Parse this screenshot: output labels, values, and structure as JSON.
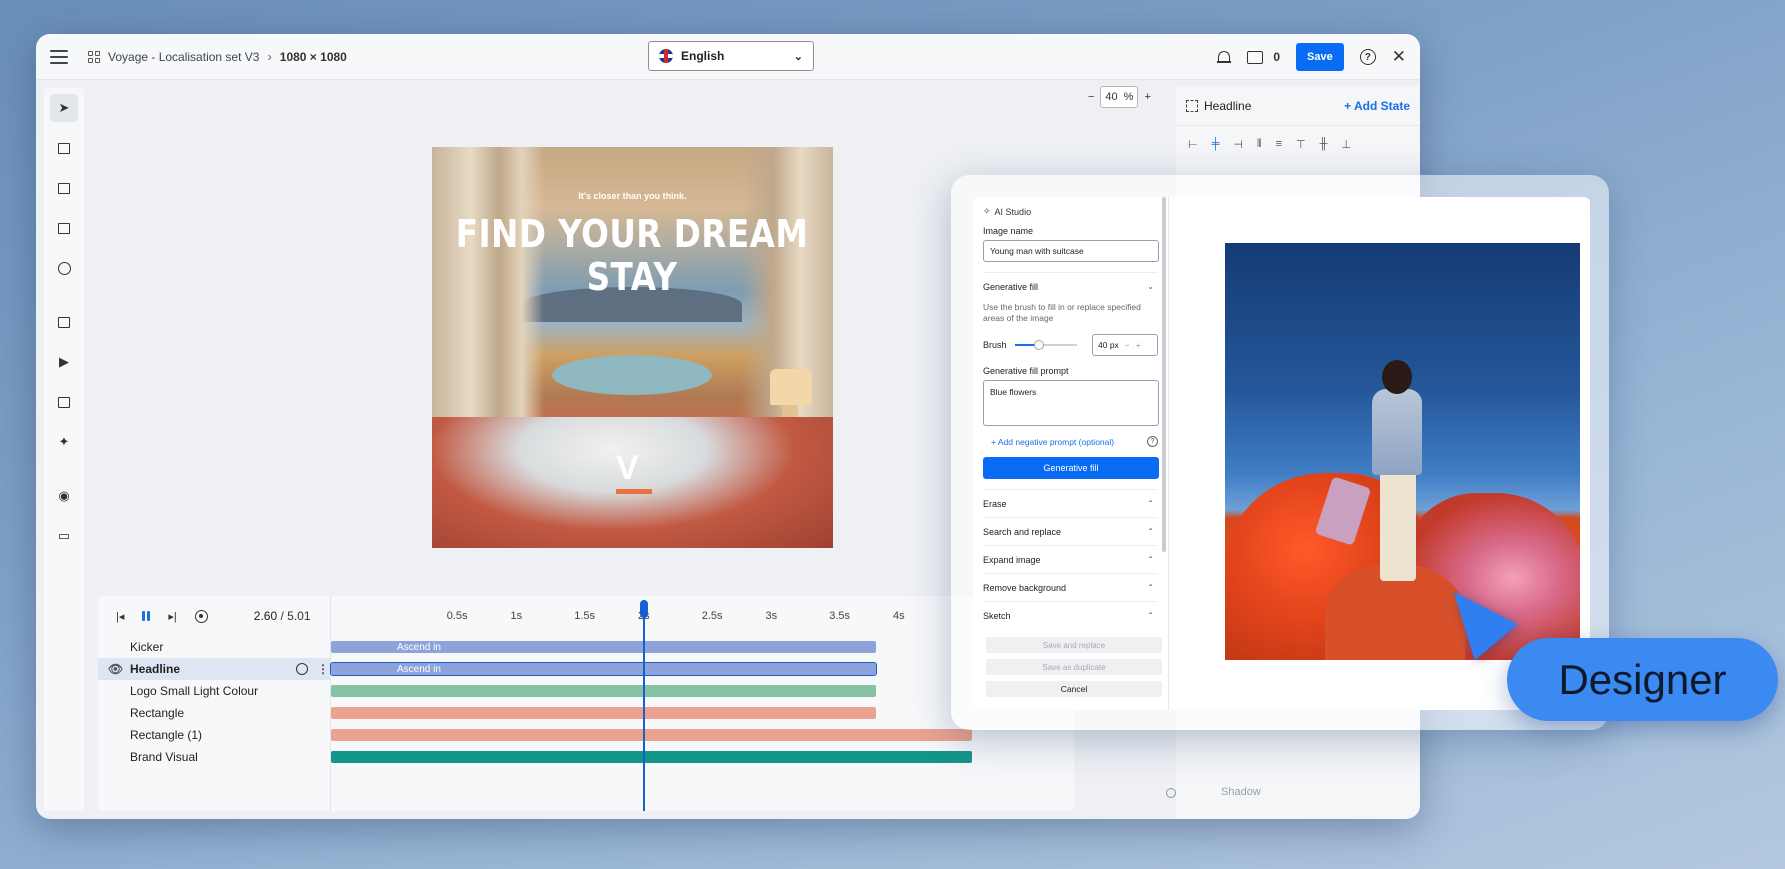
{
  "app": {
    "breadcrumb_project": "Voyage - Localisation set V3",
    "breadcrumb_size": "1080 × 1080",
    "language": "English",
    "comments_count": "0",
    "save_label": "Save"
  },
  "zoom": {
    "value": "40",
    "unit": "%",
    "minus": "−",
    "plus": "+"
  },
  "canvas": {
    "kicker": "It's closer than you think.",
    "headline": "FIND YOUR DREAM STAY",
    "logo": "V"
  },
  "right_panel": {
    "title": "Headline",
    "add_state": "+  Add State",
    "shadow_label": "Shadow"
  },
  "timeline": {
    "current_time": "2.60",
    "separator": "/",
    "total_time": "5.01",
    "ticks": [
      "0.5s",
      "1s",
      "1.5s",
      "2s",
      "2.5s",
      "3s",
      "3.5s",
      "4s"
    ],
    "playhead_seconds": 2.6,
    "layers": [
      {
        "name": "Kicker",
        "animation": "Ascend in",
        "color": "#8ea3d9"
      },
      {
        "name": "Headline",
        "animation": "Ascend in",
        "color": "#8ea3d9"
      },
      {
        "name": "Logo Small Light Colour",
        "animation": "",
        "color": "#86c3a4"
      },
      {
        "name": "Rectangle",
        "animation": "",
        "color": "#eba38f"
      },
      {
        "name": "Rectangle (1)",
        "animation": "",
        "color": "#eba38f"
      },
      {
        "name": "Brand Visual",
        "animation": "",
        "color": "#14958a"
      }
    ]
  },
  "ai_studio": {
    "title": "AI Studio",
    "image_name_label": "Image name",
    "image_name_value": "Young man with suitcase",
    "generative_fill_header": "Generative fill",
    "generative_fill_desc": "Use the brush to fill in or replace specified areas of the image",
    "brush_label": "Brush",
    "brush_size": "40 px",
    "brush_level": 0.4,
    "prompt_label": "Generative fill prompt",
    "prompt_value": "Blue flowers",
    "negative_prompt_link": "+  Add negative prompt (optional)",
    "generate_button": "Generative fill",
    "sections": [
      "Erase",
      "Search and replace",
      "Expand image",
      "Remove background",
      "Sketch"
    ],
    "save_replace": "Save and replace",
    "save_duplicate": "Save as duplicate",
    "cancel": "Cancel"
  },
  "overlay": {
    "label": "Designer"
  },
  "colors": {
    "accent": "#0a6cf5",
    "designer_pill": "#3b8af2",
    "playhead": "#1a5fd1"
  }
}
